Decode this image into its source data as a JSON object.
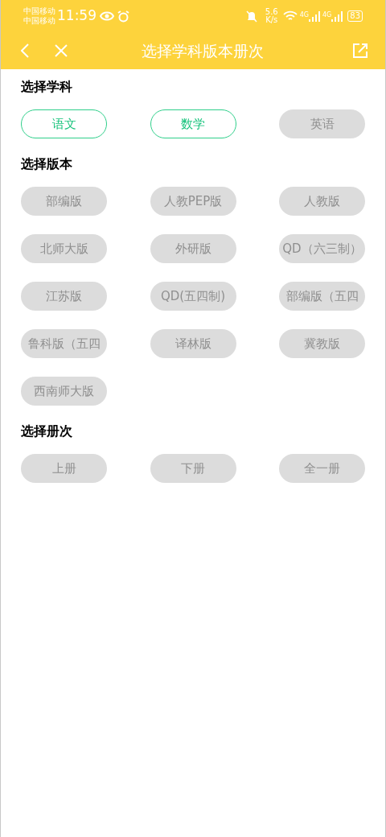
{
  "status_bar": {
    "carriers": [
      "中国移动",
      "中国移动"
    ],
    "time": "11:59",
    "speed_value": "5.6",
    "speed_unit": "K/s",
    "network_labels": [
      "4G",
      "4G"
    ],
    "battery": "83"
  },
  "header": {
    "title": "选择学科版本册次"
  },
  "sections": [
    {
      "title": "选择学科",
      "options": [
        {
          "label": "语文",
          "selected": true
        },
        {
          "label": "数学",
          "selected": true
        },
        {
          "label": "英语",
          "selected": false
        }
      ]
    },
    {
      "title": "选择版本",
      "options": [
        {
          "label": "部编版",
          "selected": false
        },
        {
          "label": "人教PEP版",
          "selected": false
        },
        {
          "label": "人教版",
          "selected": false
        },
        {
          "label": "北师大版",
          "selected": false
        },
        {
          "label": "外研版",
          "selected": false
        },
        {
          "label": "QD（六三制）",
          "selected": false
        },
        {
          "label": "江苏版",
          "selected": false
        },
        {
          "label": "QD(五四制)",
          "selected": false
        },
        {
          "label": "部编版（五四",
          "selected": false
        },
        {
          "label": "鲁科版（五四",
          "selected": false
        },
        {
          "label": "译林版",
          "selected": false
        },
        {
          "label": "冀教版",
          "selected": false
        },
        {
          "label": "西南师大版",
          "selected": false
        }
      ]
    },
    {
      "title": "选择册次",
      "options": [
        {
          "label": "上册",
          "selected": false
        },
        {
          "label": "下册",
          "selected": false
        },
        {
          "label": "全一册",
          "selected": false
        }
      ]
    }
  ]
}
